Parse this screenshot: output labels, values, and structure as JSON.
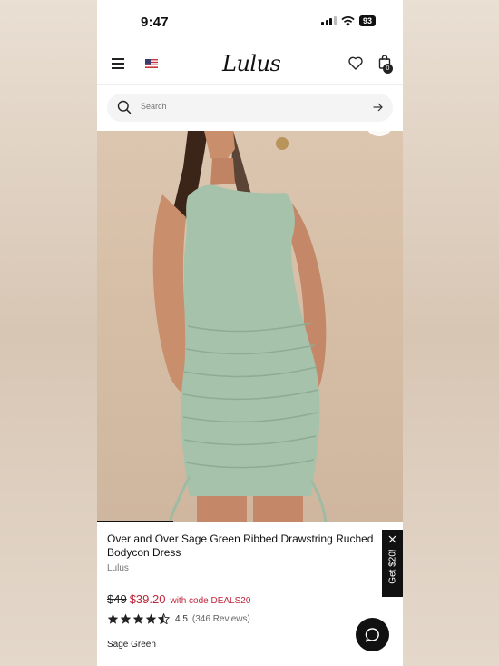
{
  "status_bar": {
    "time": "9:47",
    "battery": "93"
  },
  "nav": {
    "logo": "Lulus",
    "bag_count": "0"
  },
  "search": {
    "placeholder": "Search"
  },
  "product": {
    "title": "Over and Over Sage Green Ribbed Drawstring Ruched Bodycon Dress",
    "brand": "Lulus",
    "old_price": "$49",
    "sale_price": "$39.20",
    "promo": "with code DEALS20",
    "rating": "4.5",
    "reviews": "(346 Reviews)",
    "rating_stars": 4.5,
    "color": "Sage Green",
    "image_progress": 0.25
  },
  "promo_tab": {
    "label": "Get $20!"
  },
  "colors": {
    "accent_red": "#c0263b",
    "dress_green": "#a7c2ab",
    "skin": "#c98e6c",
    "hair": "#3b2418"
  }
}
